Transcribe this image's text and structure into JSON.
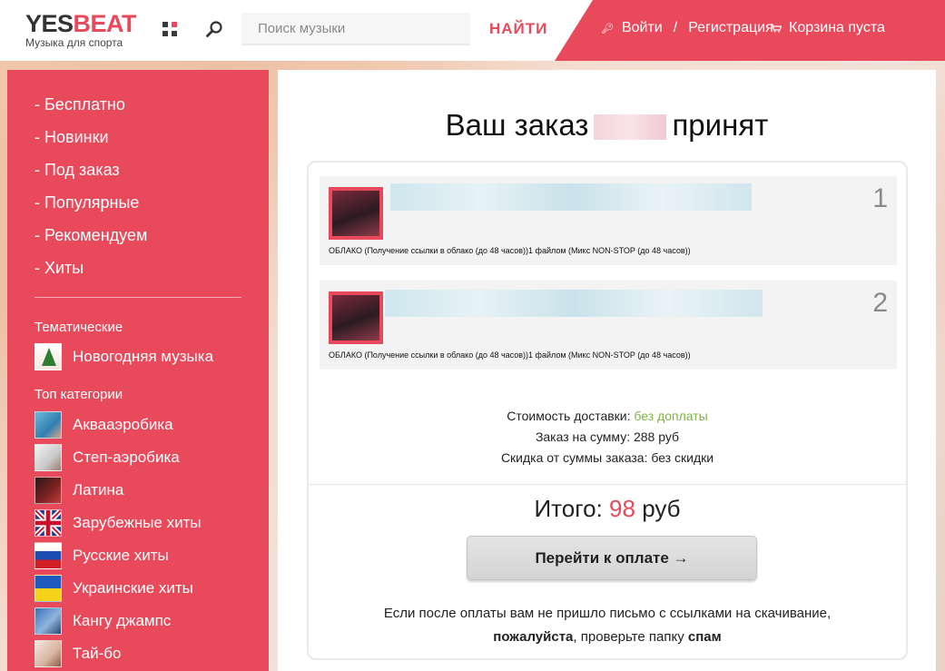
{
  "header": {
    "logo_yes": "YES",
    "logo_beat": "BEAT",
    "logo_sub": "Музыка для спорта",
    "search_placeholder": "Поиск музыки",
    "find_label": "НАЙТИ",
    "login_label": "Войти",
    "separator": "/",
    "register_label": "Регистрация",
    "cart_label": "Корзина пуста",
    "icons": [
      "grid-icon",
      "search-icon",
      "key-icon",
      "cart-icon"
    ]
  },
  "sidebar": {
    "links": [
      "- Бесплатно",
      "- Новинки",
      "- Под заказ",
      "- Популярные",
      "- Рекомендуем",
      "- Хиты"
    ],
    "thematic_heading": "Тематические",
    "thematic": [
      {
        "label": "Новогодняя музыка"
      }
    ],
    "top_heading": "Топ категории",
    "categories": [
      {
        "label": "Аквааэробика"
      },
      {
        "label": "Степ-аэробика"
      },
      {
        "label": "Латина"
      },
      {
        "label": "Зарубежные хиты"
      },
      {
        "label": "Русские хиты"
      },
      {
        "label": "Украинские хиты"
      },
      {
        "label": "Кангу джампс"
      },
      {
        "label": "Тай-бо"
      }
    ]
  },
  "order": {
    "title_prefix": "Ваш заказ",
    "title_suffix": "принят",
    "items": [
      {
        "number": "1",
        "desc": "ОБЛАКО (Получение ссылки в облако (до 48 часов))1 файлом (Микс NON-STOP (до 48 часов))"
      },
      {
        "number": "2",
        "desc": "ОБЛАКО (Получение ссылки в облако (до 48 часов))1 файлом (Микс NON-STOP (до 48 часов))"
      }
    ],
    "delivery_label": "Стоимость доставки:",
    "delivery_value": "без доплаты",
    "sum_text": "Заказ на сумму: 288 руб",
    "discount_text": "Скидка от суммы заказа: без скидки",
    "total_label": "Итого:",
    "total_value": "98",
    "total_currency": "руб",
    "pay_button": "Перейти к оплате →",
    "notice_line1": "Если после оплаты вам не пришло письмо с ссылками на скачивание,",
    "notice_please": "пожалуйста",
    "notice_mid": ", проверьте папку",
    "notice_spam": "спам"
  },
  "colors": {
    "accent": "#e8495b",
    "green": "#7cb342"
  }
}
